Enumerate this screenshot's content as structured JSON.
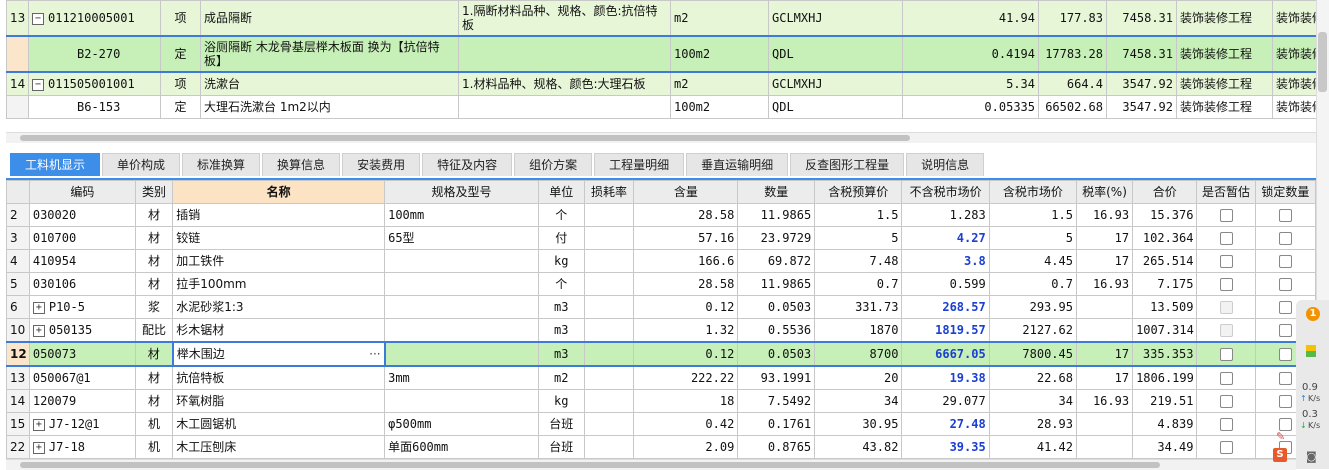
{
  "top_rows": [
    {
      "num": "13",
      "code": "011210005001",
      "kind": "项",
      "name": "成品隔断",
      "feature": "1.隔断材料品种、规格、颜色:抗倍特板",
      "unit": "m2",
      "expr": "GCLMXHJ",
      "qty": "41.94",
      "price": "177.83",
      "total": "7458.31",
      "cat1": "装饰装修工程",
      "cat2": "装饰装修工程",
      "tree": "−",
      "style": "g tall"
    },
    {
      "num": "",
      "code": "B2-270",
      "kind": "定",
      "name": "浴厕隔断 木龙骨基层榉木板面 换为【抗倍特板】",
      "feature": "",
      "unit": "100m2",
      "expr": "QDL",
      "qty": "0.4194",
      "price": "17783.28",
      "total": "7458.31",
      "cat1": "装饰装修工程",
      "cat2": "装饰装修工程",
      "tree": "",
      "style": "sel tall"
    },
    {
      "num": "14",
      "code": "011505001001",
      "kind": "项",
      "name": "洗漱台",
      "feature": "1.材料品种、规格、颜色:大理石板",
      "unit": "m2",
      "expr": "GCLMXHJ",
      "qty": "5.34",
      "price": "664.4",
      "total": "3547.92",
      "cat1": "装饰装修工程",
      "cat2": "装饰装修工程",
      "tree": "−",
      "style": "g"
    },
    {
      "num": "",
      "code": "B6-153",
      "kind": "定",
      "name": "大理石洗漱台 1m2以内",
      "feature": "",
      "unit": "100m2",
      "expr": "QDL",
      "qty": "0.05335",
      "price": "66502.68",
      "total": "3547.92",
      "cat1": "装饰装修工程",
      "cat2": "装饰装修工程",
      "tree": "",
      "style": ""
    }
  ],
  "tabs": [
    "工料机显示",
    "单价构成",
    "标准换算",
    "换算信息",
    "安装费用",
    "特征及内容",
    "组价方案",
    "工程量明细",
    "垂直运输明细",
    "反查图形工程量",
    "说明信息"
  ],
  "headers": [
    "编码",
    "类别",
    "名称",
    "规格及型号",
    "单位",
    "损耗率",
    "含量",
    "数量",
    "含税预算价",
    "不含税市场价",
    "含税市场价",
    "税率(%)",
    "合价",
    "是否暂估",
    "锁定数量"
  ],
  "rows": [
    {
      "num": "2",
      "code": "030020",
      "kind": "材",
      "name": "插销",
      "spec": "100mm",
      "unit": "个",
      "content": "28.58",
      "qty": "11.9865",
      "budget": "1.5",
      "market": "1.283",
      "mkt_blue": false,
      "market_tax": "1.5",
      "rate": "16.93",
      "total": "15.376",
      "tree": false,
      "cb1dis": false
    },
    {
      "num": "3",
      "code": "010700",
      "kind": "材",
      "name": "铰链",
      "spec": "65型",
      "unit": "付",
      "content": "57.16",
      "qty": "23.9729",
      "budget": "5",
      "market": "4.27",
      "mkt_blue": true,
      "market_tax": "5",
      "rate": "17",
      "total": "102.364",
      "tree": false,
      "cb1dis": false
    },
    {
      "num": "4",
      "code": "410954",
      "kind": "材",
      "name": "加工铁件",
      "spec": "",
      "unit": "kg",
      "content": "166.6",
      "qty": "69.872",
      "budget": "7.48",
      "market": "3.8",
      "mkt_blue": true,
      "market_tax": "4.45",
      "rate": "17",
      "total": "265.514",
      "tree": false,
      "cb1dis": false
    },
    {
      "num": "5",
      "code": "030106",
      "kind": "材",
      "name": "拉手100mm",
      "spec": "",
      "unit": "个",
      "content": "28.58",
      "qty": "11.9865",
      "budget": "0.7",
      "market": "0.599",
      "mkt_blue": false,
      "market_tax": "0.7",
      "rate": "16.93",
      "total": "7.175",
      "tree": false,
      "cb1dis": false
    },
    {
      "num": "6",
      "code": "P10-5",
      "kind": "浆",
      "name": "水泥砂浆1:3",
      "spec": "",
      "unit": "m3",
      "content": "0.12",
      "qty": "0.0503",
      "budget": "331.73",
      "market": "268.57",
      "mkt_blue": true,
      "market_tax": "293.95",
      "rate": "",
      "total": "13.509",
      "tree": true,
      "cb1dis": true
    },
    {
      "num": "10",
      "code": "050135",
      "kind": "配比",
      "name": "杉木锯材",
      "spec": "",
      "unit": "m3",
      "content": "1.32",
      "qty": "0.5536",
      "budget": "1870",
      "market": "1819.57",
      "mkt_blue": true,
      "market_tax": "2127.62",
      "rate": "",
      "total": "1007.314",
      "tree": true,
      "cb1dis": true
    },
    {
      "num": "12",
      "code": "050073",
      "kind": "材",
      "name": "榉木围边",
      "spec": "",
      "unit": "m3",
      "content": "0.12",
      "qty": "0.0503",
      "budget": "8700",
      "market": "6667.05",
      "mkt_blue": true,
      "market_tax": "7800.45",
      "rate": "17",
      "total": "335.353",
      "tree": false,
      "cb1dis": false,
      "sel": true
    },
    {
      "num": "13",
      "code": "050067@1",
      "kind": "材",
      "name": "抗倍特板",
      "spec": "3mm",
      "unit": "m2",
      "content": "222.22",
      "qty": "93.1991",
      "budget": "20",
      "market": "19.38",
      "mkt_blue": true,
      "market_tax": "22.68",
      "rate": "17",
      "total": "1806.199",
      "tree": false,
      "cb1dis": false
    },
    {
      "num": "14",
      "code": "120079",
      "kind": "材",
      "name": "环氧树脂",
      "spec": "",
      "unit": "kg",
      "content": "18",
      "qty": "7.5492",
      "budget": "34",
      "market": "29.077",
      "mkt_blue": false,
      "market_tax": "34",
      "rate": "16.93",
      "total": "219.51",
      "tree": false,
      "cb1dis": false
    },
    {
      "num": "15",
      "code": "J7-12@1",
      "kind": "机",
      "name": "木工圆锯机",
      "spec": "φ500mm",
      "unit": "台班",
      "content": "0.42",
      "qty": "0.1761",
      "budget": "30.95",
      "market": "27.48",
      "mkt_blue": true,
      "market_tax": "28.93",
      "rate": "",
      "total": "4.839",
      "tree": true,
      "cb1dis": false
    },
    {
      "num": "22",
      "code": "J7-18",
      "kind": "机",
      "name": "木工压刨床",
      "spec": "单面600mm",
      "unit": "台班",
      "content": "2.09",
      "qty": "0.8765",
      "budget": "43.82",
      "market": "39.35",
      "mkt_blue": true,
      "market_tax": "41.42",
      "rate": "",
      "total": "34.49",
      "tree": true,
      "cb1dis": false
    }
  ],
  "edit_dots": "···",
  "widget": {
    "badge": "1",
    "speed_up": "0.9",
    "speed_down": "0.3",
    "unit": "K/s",
    "s_icon": "S"
  }
}
